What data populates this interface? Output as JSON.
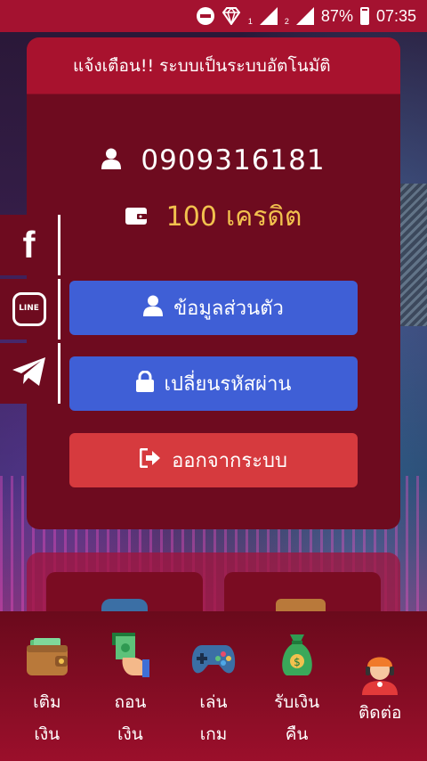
{
  "status_bar": {
    "sim1": "1",
    "sim2": "2",
    "battery": "87%",
    "time": "07:35"
  },
  "announcement": "แจ้งเตือน!! ระบบเป็นระบบอัตโนมัติ",
  "account": {
    "phone": "0909316181",
    "credit_amount": "100",
    "credit_unit": "เครดิต"
  },
  "buttons": {
    "profile": "ข้อมูลส่วนตัว",
    "password": "เปลี่ยนรหัสผ่าน",
    "logout": "ออกจากระบบ"
  },
  "social": {
    "facebook": "f",
    "line": "LINE"
  },
  "nav": {
    "deposit": [
      "เติม",
      "เงิน"
    ],
    "withdraw": [
      "ถอน",
      "เงิน"
    ],
    "play": [
      "เล่น",
      "เกม"
    ],
    "cashback": [
      "รับเงิน",
      "คืน"
    ],
    "contact": [
      "ติดต่อ"
    ]
  },
  "colors": {
    "primary": "#a41230",
    "card": "#6e0b1f",
    "button_blue": "#3f5fd6",
    "button_red": "#d63a3e",
    "credit": "#f2c14e"
  },
  "icons": [
    "user-icon",
    "wallet-icon",
    "lock-icon",
    "sign-out-icon",
    "facebook-icon",
    "line-icon",
    "telegram-icon",
    "wallet-nav-icon",
    "cash-hand-icon",
    "gamepad-icon",
    "money-bag-icon",
    "support-agent-icon"
  ]
}
